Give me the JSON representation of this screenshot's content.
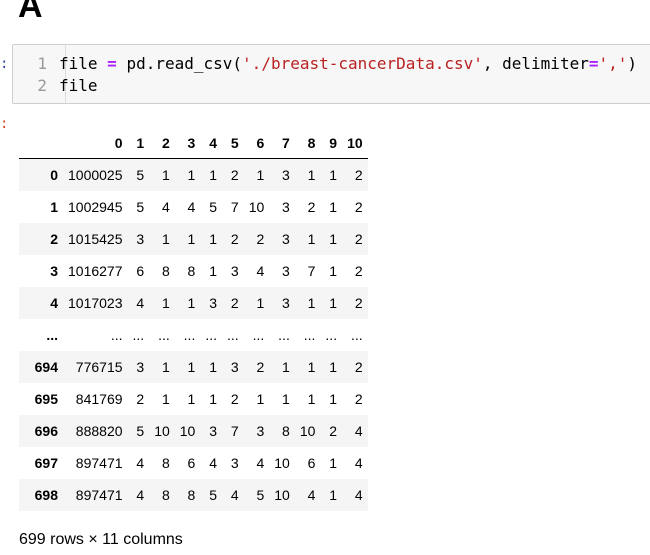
{
  "heading": "A",
  "code": {
    "line1": {
      "num": "1",
      "var": "file ",
      "op": "=",
      "call": " pd.read_csv(",
      "str1": "'./breast-cancerData.csv'",
      "mid": ", delimiter",
      "op2": "=",
      "str2": "','",
      "end": ")"
    },
    "line2": {
      "num": "2",
      "text": "file"
    }
  },
  "table": {
    "columns": [
      "0",
      "1",
      "2",
      "3",
      "4",
      "5",
      "6",
      "7",
      "8",
      "9",
      "10"
    ],
    "rows": [
      {
        "index": "0",
        "cells": [
          "1000025",
          "5",
          "1",
          "1",
          "1",
          "2",
          "1",
          "3",
          "1",
          "1",
          "2"
        ]
      },
      {
        "index": "1",
        "cells": [
          "1002945",
          "5",
          "4",
          "4",
          "5",
          "7",
          "10",
          "3",
          "2",
          "1",
          "2"
        ]
      },
      {
        "index": "2",
        "cells": [
          "1015425",
          "3",
          "1",
          "1",
          "1",
          "2",
          "2",
          "3",
          "1",
          "1",
          "2"
        ]
      },
      {
        "index": "3",
        "cells": [
          "1016277",
          "6",
          "8",
          "8",
          "1",
          "3",
          "4",
          "3",
          "7",
          "1",
          "2"
        ]
      },
      {
        "index": "4",
        "cells": [
          "1017023",
          "4",
          "1",
          "1",
          "3",
          "2",
          "1",
          "3",
          "1",
          "1",
          "2"
        ]
      },
      {
        "index": "...",
        "cells": [
          "...",
          "...",
          "...",
          "...",
          "...",
          "...",
          "...",
          "...",
          "...",
          "...",
          "..."
        ]
      },
      {
        "index": "694",
        "cells": [
          "776715",
          "3",
          "1",
          "1",
          "1",
          "3",
          "2",
          "1",
          "1",
          "1",
          "2"
        ]
      },
      {
        "index": "695",
        "cells": [
          "841769",
          "2",
          "1",
          "1",
          "1",
          "2",
          "1",
          "1",
          "1",
          "1",
          "2"
        ]
      },
      {
        "index": "696",
        "cells": [
          "888820",
          "5",
          "10",
          "10",
          "3",
          "7",
          "3",
          "8",
          "10",
          "2",
          "4"
        ]
      },
      {
        "index": "697",
        "cells": [
          "897471",
          "4",
          "8",
          "6",
          "4",
          "3",
          "4",
          "10",
          "6",
          "1",
          "4"
        ]
      },
      {
        "index": "698",
        "cells": [
          "897471",
          "4",
          "8",
          "8",
          "5",
          "4",
          "5",
          "10",
          "4",
          "1",
          "4"
        ]
      }
    ]
  },
  "shape_text": "699 rows × 11 columns"
}
